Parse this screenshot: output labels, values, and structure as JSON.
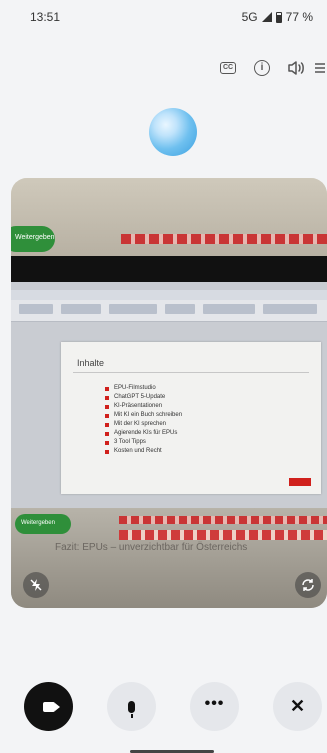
{
  "status_bar": {
    "time": "13:51",
    "network": "5G",
    "battery": "77 %"
  },
  "top_icons": {
    "captions_label": "CC",
    "info_label": "i"
  },
  "video_feed": {
    "slide": {
      "title": "Inhalte",
      "items": [
        "EPU-Filmstudio",
        "ChatGPT 5-Update",
        "KI-Präsentationen",
        "Mit KI ein Buch schreiben",
        "Mit der KI sprechen",
        "Agierende KIs für EPUs",
        "3 Tool Tipps",
        "Kosten und Recht"
      ]
    },
    "green_button_label": "Weitergeben",
    "caption": "Fazit: EPUs – unverzichtbar für Österreichs"
  },
  "controls": {
    "video": {
      "name": "video-camera"
    },
    "mic": {
      "name": "microphone"
    },
    "more": {
      "label": "•••"
    },
    "end": {
      "label": "✕"
    }
  },
  "colors": {
    "bullet": "#d0201c",
    "control_active": "#111111",
    "control_idle": "#e5e7eb"
  }
}
